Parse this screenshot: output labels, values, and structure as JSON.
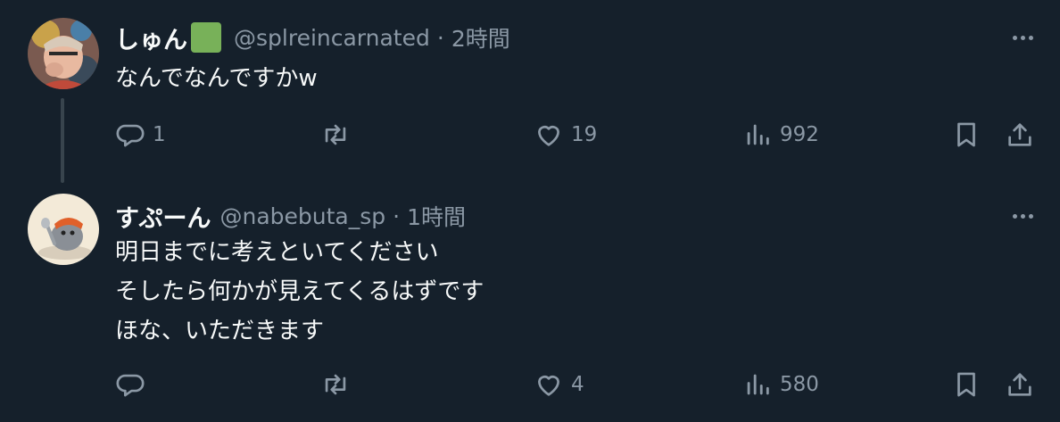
{
  "tweets": [
    {
      "display_name": "しゅん",
      "badge_icon": "green-square-emoji",
      "handle": "@splreincarnated",
      "separator": "·",
      "time": "2時間",
      "lines": [
        "なんでなんですかw"
      ],
      "actions": {
        "reply_count": "1",
        "retweet_count": "",
        "like_count": "19",
        "view_count": "992"
      }
    },
    {
      "display_name": "すぷーん",
      "handle": "@nabebuta_sp",
      "separator": "·",
      "time": "1時間",
      "lines": [
        "明日までに考えといてください",
        "そしたら何かが見えてくるはずです",
        "ほな、いただきます"
      ],
      "actions": {
        "reply_count": "",
        "retweet_count": "",
        "like_count": "4",
        "view_count": "580"
      }
    }
  ],
  "colors": {
    "background": "#15202b",
    "text_primary": "#f7f9f9",
    "text_secondary": "#8b98a5",
    "thread_line": "#38444d",
    "badge_green": "#78b159"
  }
}
